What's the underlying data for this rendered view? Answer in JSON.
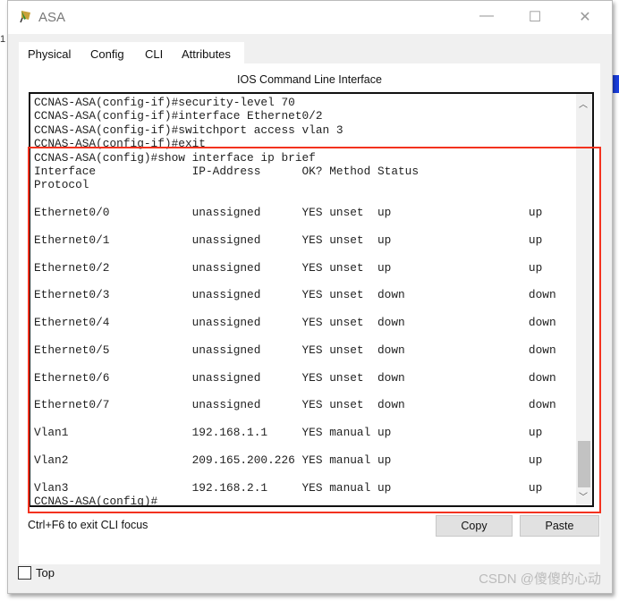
{
  "window": {
    "title": "ASA",
    "minimize": "—",
    "maximize": "☐",
    "close": "✕"
  },
  "tabs": [
    {
      "label": "Physical"
    },
    {
      "label": "Config"
    },
    {
      "label": "CLI"
    },
    {
      "label": "Attributes"
    }
  ],
  "panel_title": "IOS Command Line Interface",
  "terminal": {
    "lines": [
      "CCNAS-ASA(config-if)#security-level 70",
      "CCNAS-ASA(config-if)#interface Ethernet0/2",
      "CCNAS-ASA(config-if)#switchport access vlan 3",
      "CCNAS-ASA(config-if)#exit",
      "CCNAS-ASA(config)#show interface ip brief",
      "Interface              IP-Address      OK? Method Status",
      "Protocol",
      "",
      "Ethernet0/0            unassigned      YES unset  up                    up",
      "",
      "Ethernet0/1            unassigned      YES unset  up                    up",
      "",
      "Ethernet0/2            unassigned      YES unset  up                    up",
      "",
      "Ethernet0/3            unassigned      YES unset  down                  down",
      "",
      "Ethernet0/4            unassigned      YES unset  down                  down",
      "",
      "Ethernet0/5            unassigned      YES unset  down                  down",
      "",
      "Ethernet0/6            unassigned      YES unset  down                  down",
      "",
      "Ethernet0/7            unassigned      YES unset  down                  down",
      "",
      "Vlan1                  192.168.1.1     YES manual up                    up",
      "",
      "Vlan2                  209.165.200.226 YES manual up                    up",
      "",
      "Vlan3                  192.168.2.1     YES manual up                    up",
      "CCNAS-ASA(config)#"
    ]
  },
  "hint": "Ctrl+F6 to exit CLI focus",
  "copy_label": "Copy",
  "paste_label": "Paste",
  "top_label": "Top",
  "watermark": "CSDN @傻傻的心动",
  "accent": "#f3321f"
}
